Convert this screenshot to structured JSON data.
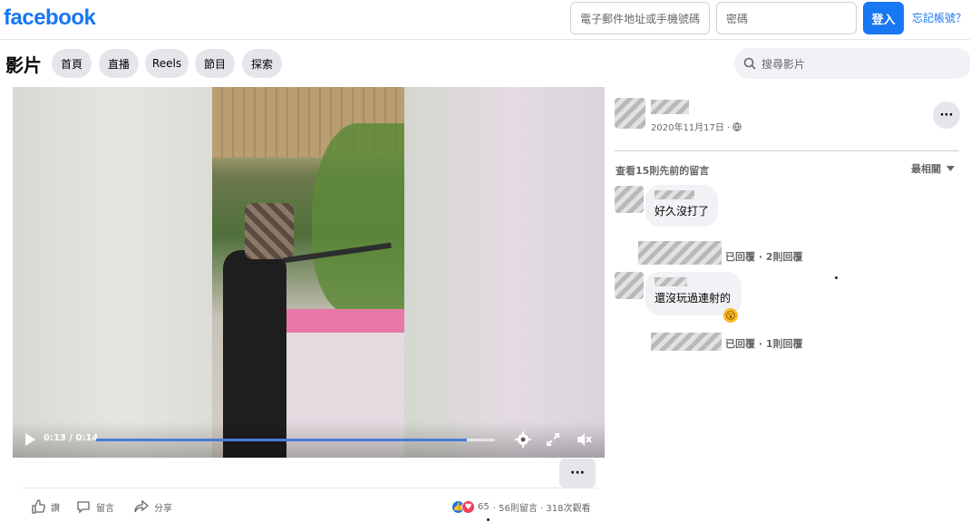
{
  "header": {
    "logo": "facebook",
    "email_placeholder": "電子郵件地址或手機號碼",
    "password_placeholder": "密碼",
    "login_label": "登入",
    "forgot_label": "忘記帳號？",
    "brand_color": "#1877f2"
  },
  "nav": {
    "title": "影片",
    "tabs": [
      {
        "label": "首頁"
      },
      {
        "label": "直播"
      },
      {
        "label": "Reels"
      },
      {
        "label": "節目"
      },
      {
        "label": "探索"
      }
    ],
    "search_placeholder": "搜尋影片"
  },
  "video": {
    "time": "0:13 / 0:14",
    "progress": 0.93,
    "icons": [
      "play-icon",
      "gear-icon",
      "fullscreen-icon",
      "volume-muted-icon"
    ]
  },
  "actions": {
    "like": "讚",
    "comment": "留言",
    "share": "分享",
    "more": "···",
    "reaction_count": "65",
    "stats": "· 56則留言 · 318次觀看"
  },
  "post": {
    "date": "2020年11月17日 ·",
    "privacy_icon": "globe-icon",
    "more": "···"
  },
  "comments": {
    "view_previous": "查看15則先前的留言",
    "sort_label": "最相關",
    "items": [
      {
        "text": "好久沒打了",
        "replies": "已回覆 · 2則回覆",
        "emoji": ""
      },
      {
        "text": "還沒玩過連射的",
        "replies": "已回覆 · 1則回覆",
        "emoji": "😮"
      }
    ]
  }
}
